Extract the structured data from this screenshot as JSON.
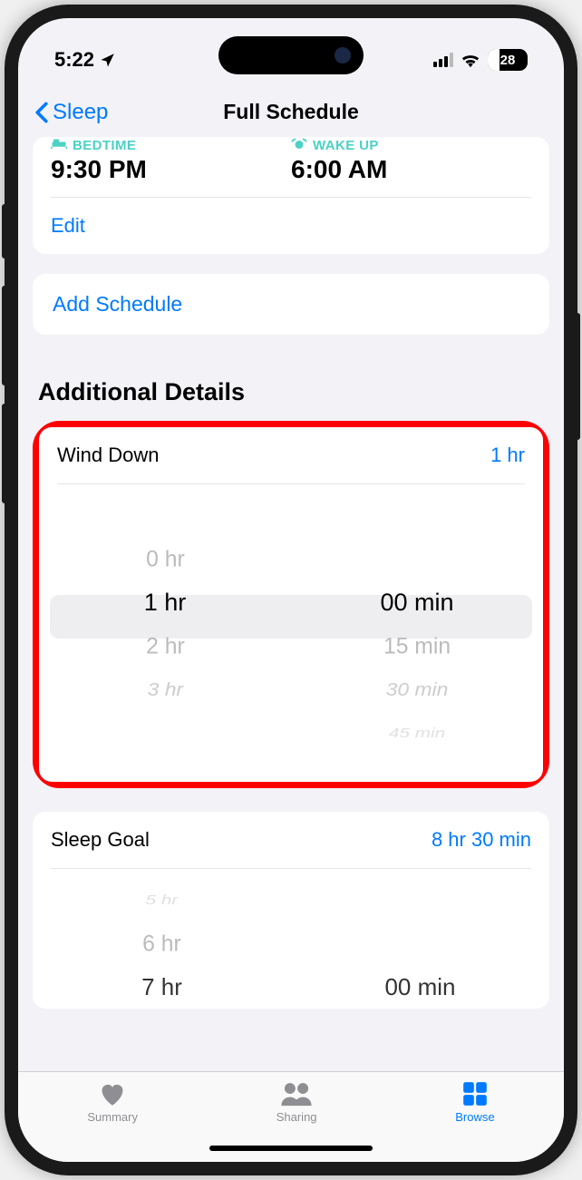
{
  "status": {
    "time": "5:22",
    "battery": "28"
  },
  "nav": {
    "back": "Sleep",
    "title": "Full Schedule"
  },
  "schedule": {
    "bedtime_label": "BEDTIME",
    "bedtime": "9:30 PM",
    "wakeup_label": "WAKE UP",
    "wakeup": "6:00 AM",
    "edit": "Edit"
  },
  "add_schedule": "Add Schedule",
  "section_title": "Additional Details",
  "wind_down": {
    "label": "Wind Down",
    "value": "1 hr",
    "hours": [
      "",
      "0 hr",
      "1 hr",
      "2 hr",
      "3 hr"
    ],
    "minutes": [
      "",
      "",
      "00 min",
      "15 min",
      "30 min",
      "45 min"
    ]
  },
  "sleep_goal": {
    "label": "Sleep Goal",
    "value": "8 hr 30 min",
    "hours": [
      "5 hr",
      "6 hr",
      "7 hr"
    ],
    "minutes": [
      "",
      "",
      "00 min"
    ]
  },
  "tabs": {
    "summary": "Summary",
    "sharing": "Sharing",
    "browse": "Browse"
  }
}
